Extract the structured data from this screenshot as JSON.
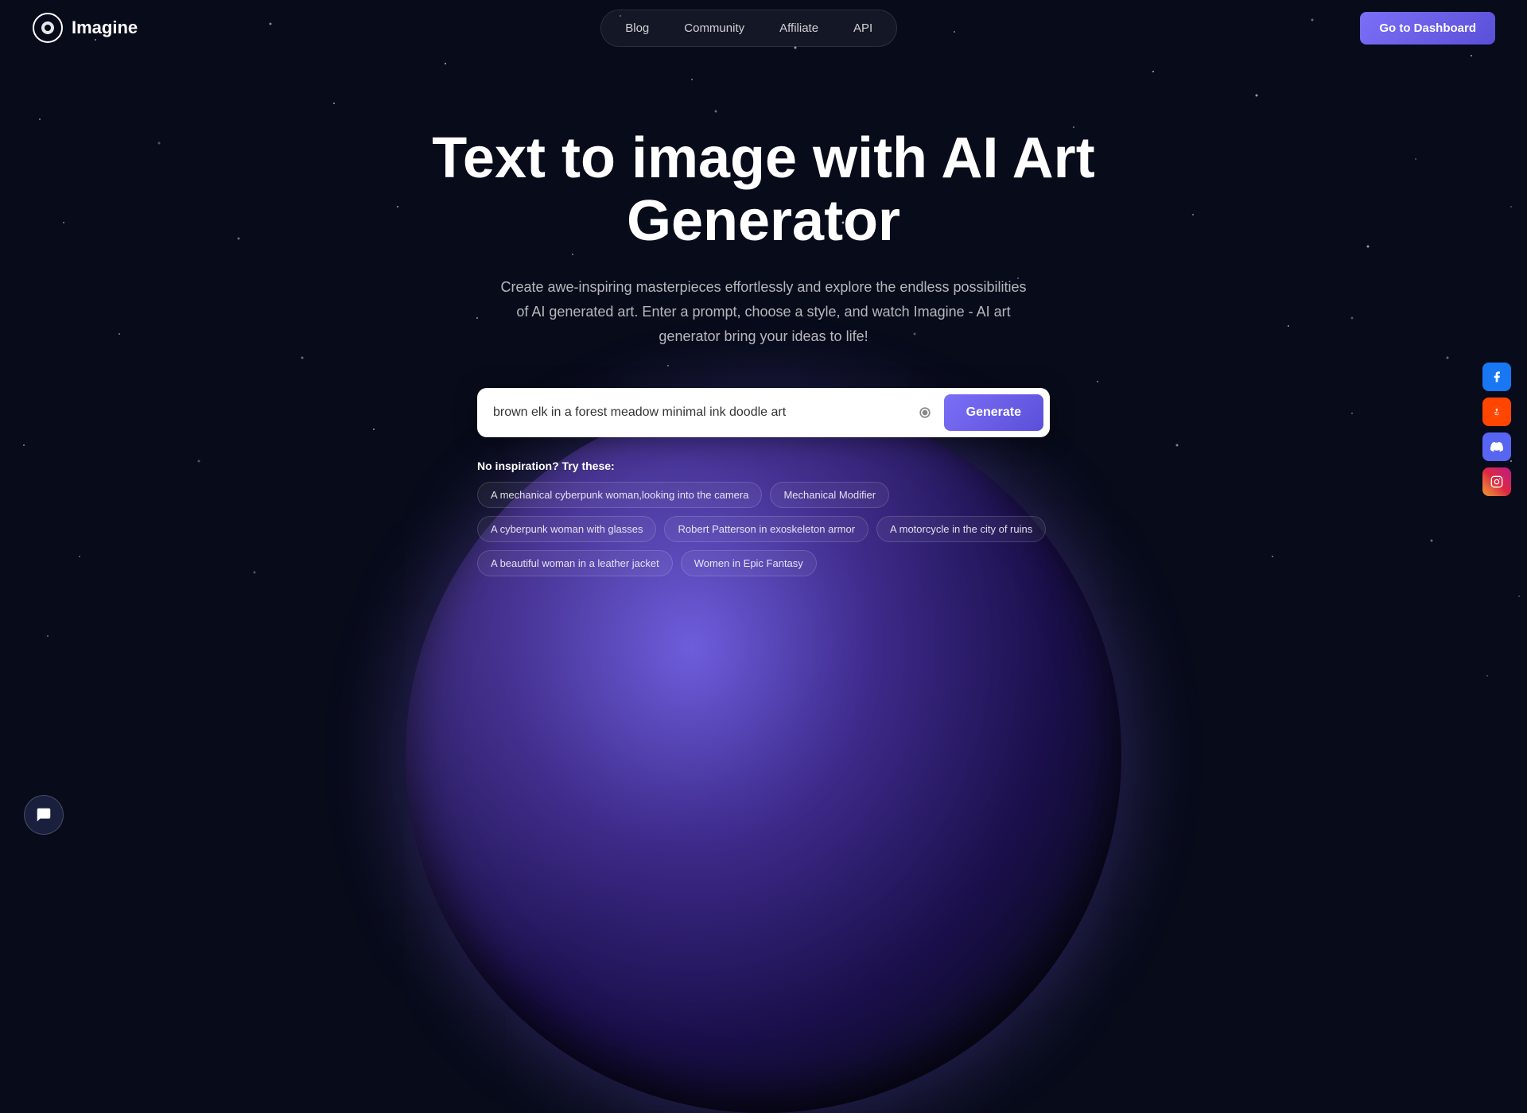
{
  "logo": {
    "text": "Imagine"
  },
  "navbar": {
    "links": [
      {
        "label": "Blog",
        "id": "blog"
      },
      {
        "label": "Community",
        "id": "community"
      },
      {
        "label": "Affiliate",
        "id": "affiliate"
      },
      {
        "label": "API",
        "id": "api"
      }
    ],
    "dashboard_button": "Go to Dashboard"
  },
  "hero": {
    "headline_line1": "Text to image with AI Art",
    "headline_line2": "Generator",
    "subtitle": "Create awe-inspiring masterpieces effortlessly and explore the endless possibilities of AI generated art. Enter a prompt, choose a style, and watch Imagine - AI art generator bring your ideas to life!"
  },
  "search": {
    "placeholder": "brown elk in a forest meadow minimal ink doodle art",
    "current_value": "brown elk in a forest meadow minimal ink doodle art",
    "generate_label": "Generate"
  },
  "inspiration": {
    "prefix": "No inspiration? Try these:",
    "tags": [
      "A mechanical cyberpunk woman,looking into the camera",
      "Mechanical Modifier",
      "A cyberpunk woman with glasses",
      "Robert Patterson in exoskeleton armor",
      "A motorcycle in the city of ruins",
      "A beautiful woman in a leather jacket",
      "Women in Epic Fantasy"
    ]
  },
  "social": {
    "items": [
      {
        "name": "facebook",
        "icon": "f",
        "label": "Facebook"
      },
      {
        "name": "reddit",
        "icon": "r",
        "label": "Reddit"
      },
      {
        "name": "discord",
        "icon": "d",
        "label": "Discord"
      },
      {
        "name": "instagram",
        "icon": "i",
        "label": "Instagram"
      }
    ]
  },
  "chat": {
    "icon": "💬"
  }
}
